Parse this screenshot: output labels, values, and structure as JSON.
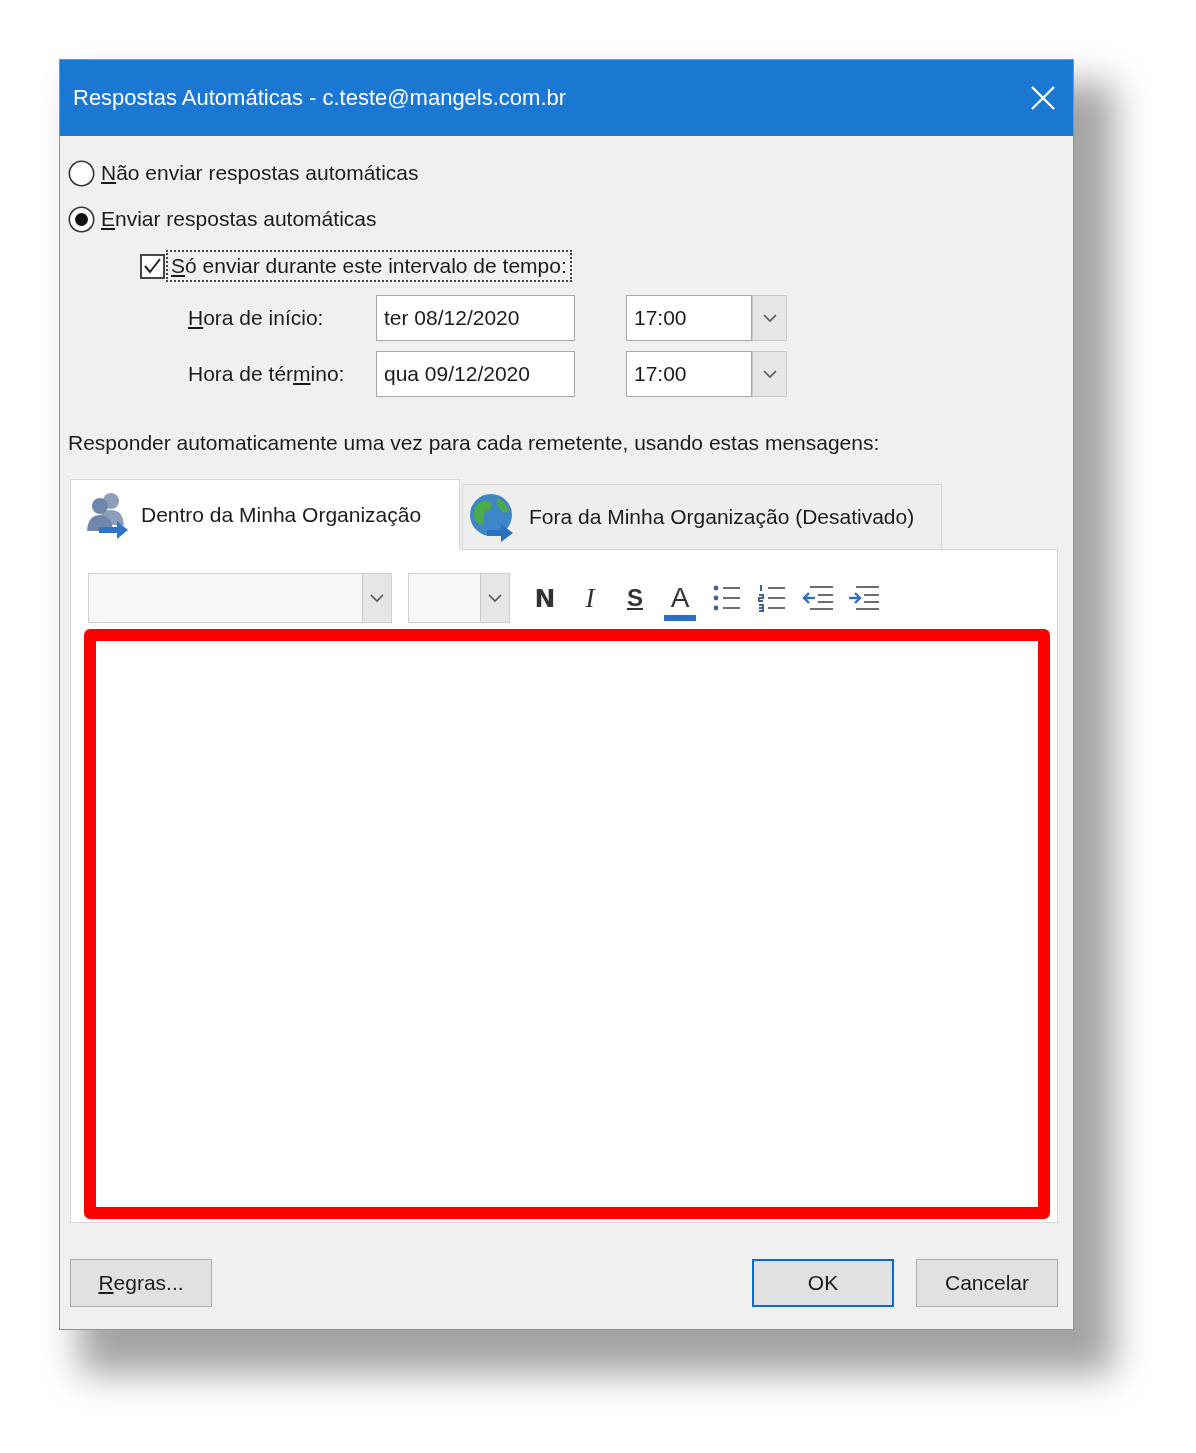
{
  "window": {
    "title": "Respostas Automáticas - c.teste@mangels.com.br"
  },
  "reply_options": [
    {
      "label": {
        "key": "N",
        "after": "ão enviar respostas automáticas"
      },
      "selected": false
    },
    {
      "label": {
        "key": "E",
        "after": "nviar respostas automáticas"
      },
      "selected": true
    }
  ],
  "time_range": {
    "label": {
      "key": "S",
      "after": "ó enviar durante este intervalo de tempo:"
    },
    "checked": true,
    "focused": true,
    "rows": [
      {
        "label": {
          "key": "H",
          "after": "ora de início:"
        },
        "date": "ter 08/12/2020",
        "time": "17:00"
      },
      {
        "label": {
          "before": "Hora de tér",
          "key": "m",
          "after": "ino:"
        },
        "date": "qua 09/12/2020",
        "time": "17:00"
      }
    ]
  },
  "instructions": "Responder automaticamente uma vez para cada remetente, usando estas mensagens:",
  "tabs": [
    {
      "label": "Dentro da Minha Organização",
      "selected": true,
      "kind": "internal"
    },
    {
      "label": "Fora da Minha Organização (Desativado)",
      "selected": false,
      "kind": "external"
    }
  ],
  "toolbar": [
    {
      "kind": "font-select"
    },
    {
      "kind": "size-select"
    },
    {
      "kind": "bold",
      "label": "N"
    },
    {
      "kind": "italic",
      "label": "I"
    },
    {
      "kind": "underline",
      "label": "S"
    },
    {
      "kind": "font-color",
      "label": "A"
    },
    {
      "kind": "bullets"
    },
    {
      "kind": "numbering"
    },
    {
      "kind": "decrease-indent"
    },
    {
      "kind": "increase-indent"
    }
  ],
  "buttons": [
    {
      "label": {
        "key": "R",
        "after": "egras..."
      },
      "default": false,
      "kind": "left"
    },
    {
      "label": "OK",
      "default": true,
      "kind": "right"
    },
    {
      "label": "Cancelar",
      "default": false,
      "kind": "right"
    }
  ]
}
